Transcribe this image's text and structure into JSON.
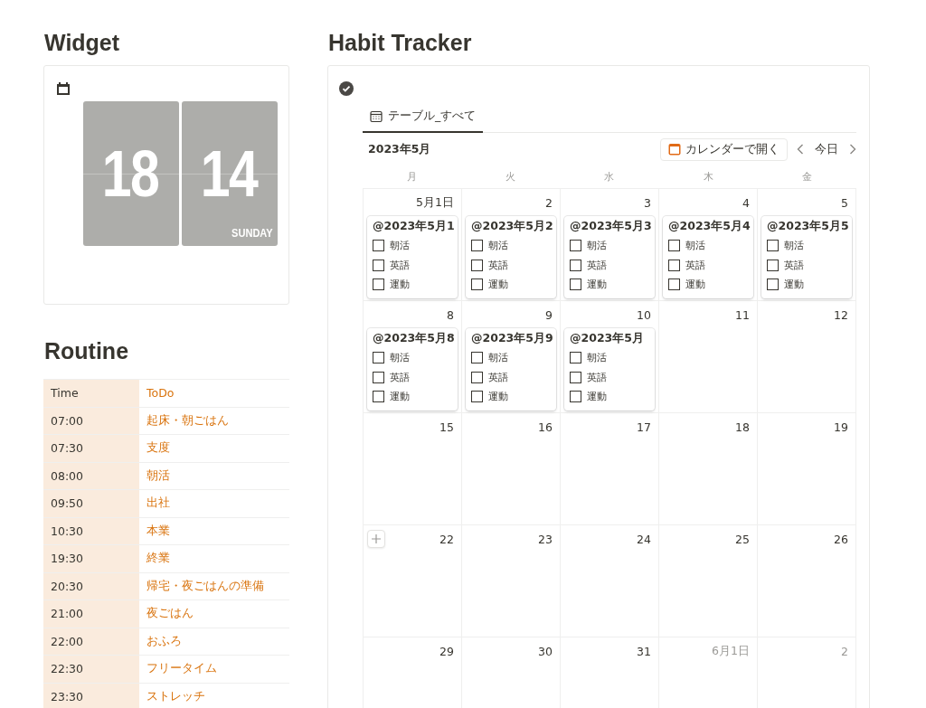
{
  "widget": {
    "title": "Widget",
    "clock": {
      "hour": "18",
      "minute": "14",
      "weekday": "SUNDAY"
    }
  },
  "routine": {
    "title": "Routine",
    "columns": [
      "Time",
      "ToDo"
    ],
    "rows": [
      {
        "time": "07:00",
        "todo": "起床・朝ごはん"
      },
      {
        "time": "07:30",
        "todo": "支度"
      },
      {
        "time": "08:00",
        "todo": "朝活"
      },
      {
        "time": "09:50",
        "todo": "出社"
      },
      {
        "time": "10:30",
        "todo": "本業"
      },
      {
        "time": "19:30",
        "todo": "終業"
      },
      {
        "time": "20:30",
        "todo": "帰宅・夜ごはんの準備"
      },
      {
        "time": "21:00",
        "todo": "夜ごはん"
      },
      {
        "time": "22:00",
        "todo": "おふろ"
      },
      {
        "time": "22:30",
        "todo": "フリータイム"
      },
      {
        "time": "23:30",
        "todo": "ストレッチ"
      }
    ]
  },
  "habit_tracker": {
    "title": "Habit Tracker",
    "tabs": [
      {
        "label": "テーブル_すべて",
        "selected": true
      }
    ],
    "month": "2023年5月",
    "open_calendar_button": "カレンダーで開く",
    "today_button": "今日",
    "weekdays": [
      "月",
      "火",
      "水",
      "木",
      "金"
    ],
    "weeks": [
      [
        {
          "label": "5月1日",
          "muted": false,
          "cards": [
            {
              "title": "@2023年5月1",
              "items": [
                {
                  "label": "朝活",
                  "checked": false
                },
                {
                  "label": "英語",
                  "checked": false
                },
                {
                  "label": "運動",
                  "checked": false
                }
              ]
            }
          ]
        },
        {
          "label": "2",
          "muted": false,
          "cards": [
            {
              "title": "@2023年5月2",
              "items": [
                {
                  "label": "朝活",
                  "checked": false
                },
                {
                  "label": "英語",
                  "checked": false
                },
                {
                  "label": "運動",
                  "checked": false
                }
              ]
            }
          ]
        },
        {
          "label": "3",
          "muted": false,
          "cards": [
            {
              "title": "@2023年5月3",
              "items": [
                {
                  "label": "朝活",
                  "checked": false
                },
                {
                  "label": "英語",
                  "checked": false
                },
                {
                  "label": "運動",
                  "checked": false
                }
              ]
            }
          ]
        },
        {
          "label": "4",
          "muted": false,
          "cards": [
            {
              "title": "@2023年5月4",
              "items": [
                {
                  "label": "朝活",
                  "checked": false
                },
                {
                  "label": "英語",
                  "checked": false
                },
                {
                  "label": "運動",
                  "checked": false
                }
              ]
            }
          ]
        },
        {
          "label": "5",
          "muted": false,
          "cards": [
            {
              "title": "@2023年5月5",
              "items": [
                {
                  "label": "朝活",
                  "checked": false
                },
                {
                  "label": "英語",
                  "checked": false
                },
                {
                  "label": "運動",
                  "checked": false
                }
              ]
            }
          ]
        }
      ],
      [
        {
          "label": "8",
          "muted": false,
          "cards": [
            {
              "title": "@2023年5月8",
              "items": [
                {
                  "label": "朝活",
                  "checked": false
                },
                {
                  "label": "英語",
                  "checked": false
                },
                {
                  "label": "運動",
                  "checked": false
                }
              ]
            }
          ]
        },
        {
          "label": "9",
          "muted": false,
          "cards": [
            {
              "title": "@2023年5月9",
              "items": [
                {
                  "label": "朝活",
                  "checked": false
                },
                {
                  "label": "英語",
                  "checked": false
                },
                {
                  "label": "運動",
                  "checked": false
                }
              ]
            }
          ]
        },
        {
          "label": "10",
          "muted": false,
          "cards": [
            {
              "title": "@2023年5月",
              "items": [
                {
                  "label": "朝活",
                  "checked": false
                },
                {
                  "label": "英語",
                  "checked": false
                },
                {
                  "label": "運動",
                  "checked": false
                }
              ]
            }
          ]
        },
        {
          "label": "11",
          "muted": false
        },
        {
          "label": "12",
          "muted": false
        }
      ],
      [
        {
          "label": "15",
          "muted": false
        },
        {
          "label": "16",
          "muted": false
        },
        {
          "label": "17",
          "muted": false
        },
        {
          "label": "18",
          "muted": false
        },
        {
          "label": "19",
          "muted": false
        }
      ],
      [
        {
          "label": "22",
          "muted": false,
          "add_button": true
        },
        {
          "label": "23",
          "muted": false
        },
        {
          "label": "24",
          "muted": false
        },
        {
          "label": "25",
          "muted": false
        },
        {
          "label": "26",
          "muted": false
        }
      ],
      [
        {
          "label": "29",
          "muted": false
        },
        {
          "label": "30",
          "muted": false
        },
        {
          "label": "31",
          "muted": false
        },
        {
          "label": "6月1日",
          "muted": true
        },
        {
          "label": "2",
          "muted": true
        }
      ]
    ]
  }
}
